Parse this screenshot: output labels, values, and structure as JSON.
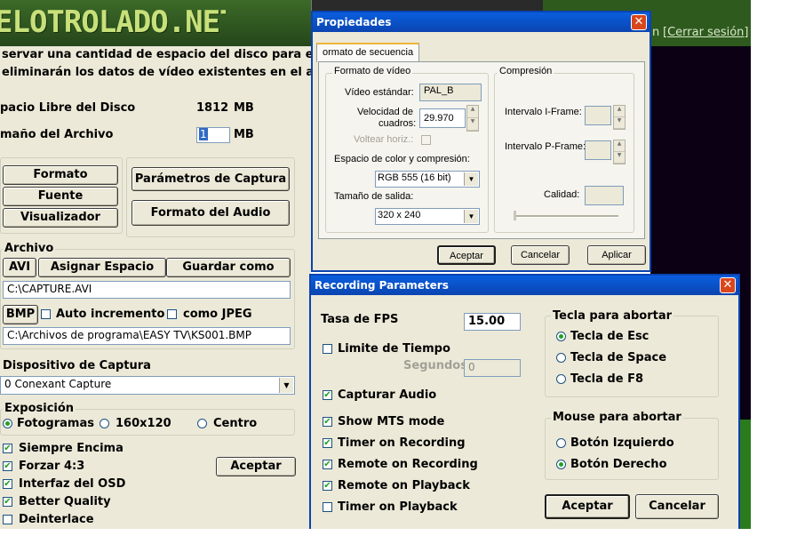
{
  "banner": {
    "logo_text": "ELOTROLADO.NET",
    "logout_link": "[Cerrar sesión]",
    "link_prefix": "n "
  },
  "main": {
    "info_line1": "servar una cantidad de espacio del disco para el archivo",
    "info_line2": "eliminarán los datos de vídeo existentes en el archivo",
    "free_space_label": "pacio Libre del Disco",
    "free_space_value": "1812",
    "free_space_unit": "MB",
    "file_size_label": "maño del Archivo",
    "file_size_value": "1",
    "file_size_unit": "MB",
    "btn_formato": "Formato",
    "btn_fuente": "Fuente",
    "btn_visualizador": "Visualizador",
    "btn_parametros": "Parámetros de Captura",
    "btn_formato_audio": "Formato del Audio",
    "archivo_group": "Archivo",
    "btn_avi": "AVI",
    "btn_asignar": "Asignar Espacio",
    "btn_guardar": "Guardar como",
    "avi_path": "C:\\CAPTURE.AVI",
    "btn_bmp": "BMP",
    "auto_incremento": "Auto incremento",
    "como_jpeg": "como JPEG",
    "bmp_path": "C:\\Archivos de programa\\EASY TV\\KS001.BMP",
    "dispositivo_label": "Dispositivo de Captura",
    "dispositivo_value": "0 Conexant Capture",
    "exposicion_group": "Exposición",
    "radio_fotogramas": "Fotogramas",
    "radio_160": "160x120",
    "radio_centro": "Centro",
    "chk_siempre": "Siempre Encima",
    "chk_forzar": "Forzar 4:3",
    "chk_osd": "Interfaz del OSD",
    "chk_quality": "Better Quality",
    "chk_deinterlace": "Deinterlace",
    "btn_aceptar": "Aceptar"
  },
  "propiedades": {
    "title": "Propiedades",
    "tab": "ormato de secuencia",
    "video_group": "Formato de vídeo",
    "video_std_label": "Vídeo estándar:",
    "video_std_value": "PAL_B",
    "fps_label1": "Velocidad de",
    "fps_label2": "cuadros:",
    "fps_value": "29.970",
    "flip_label": "Voltear horiz.:",
    "colorspace_label": "Espacio de color y compresión:",
    "colorspace_value": "RGB 555 (16 bit)",
    "output_size_label": "Tamaño de salida:",
    "output_size_value": "320 x 240",
    "compression_group": "Compresión",
    "iframe_label": "Intervalo I-Frame:",
    "pframe_label": "Intervalo P-Frame:",
    "quality_label": "Calidad:",
    "btn_ok": "Aceptar",
    "btn_cancel": "Cancelar",
    "btn_apply": "Aplicar"
  },
  "recording": {
    "title": "Recording Parameters",
    "fps_label": "Tasa de FPS",
    "fps_value": "15.00",
    "time_limit": "Limite de Tiempo",
    "seconds_label": "Segundos",
    "seconds_value": "0",
    "capture_audio": "Capturar Audio",
    "show_mts": "Show MTS mode",
    "timer_rec": "Timer on Recording",
    "remote_rec": "Remote on Recording",
    "remote_play": "Remote on Playback",
    "timer_play": "Timer on Playback",
    "abort_key_group": "Tecla para abortar",
    "key_esc": "Tecla de Esc",
    "key_space": "Tecla de Space",
    "key_f8": "Tecla de F8",
    "abort_mouse_group": "Mouse para abortar",
    "mouse_left": "Botón Izquierdo",
    "mouse_right": "Botón Derecho",
    "btn_ok": "Aceptar",
    "btn_cancel": "Cancelar"
  },
  "colors": {
    "dialog_bg": "#ece9d8",
    "titlebar": "#0a52d0",
    "banner_green": "#2e5a1e",
    "check_green": "#21a121"
  },
  "check_mark": "✔"
}
